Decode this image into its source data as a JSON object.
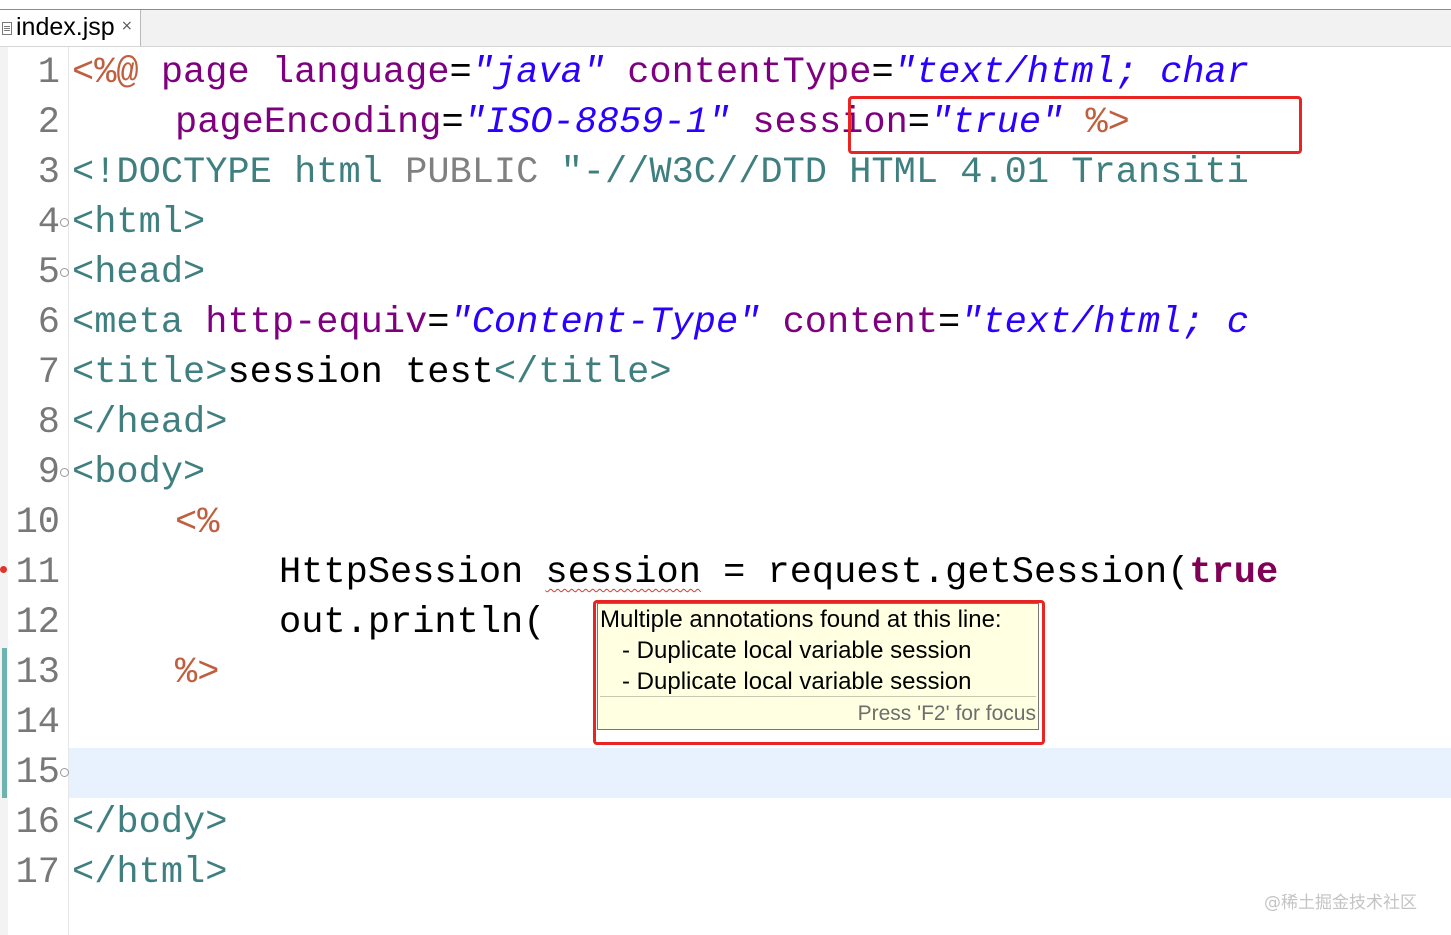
{
  "editor_tab": {
    "title": "index.jsp",
    "close_symbol": "×"
  },
  "line_numbers": [
    "1",
    "2",
    "3",
    "4",
    "5",
    "6",
    "7",
    "8",
    "9",
    "10",
    "11",
    "12",
    "13",
    "14",
    "15",
    "16",
    "17"
  ],
  "code": {
    "l1": {
      "a": "<%@",
      "b": "page",
      "c": "language",
      "d": "=",
      "e": "\"java\"",
      "f": "contentType",
      "g": "=",
      "h": "\"text/html; char"
    },
    "l2": {
      "a": "pageEncoding",
      "b": "=",
      "c": "\"ISO-8859-1\"",
      "d": "session",
      "e": "=",
      "f": "\"true\"",
      "g": "%>"
    },
    "l3": {
      "a": "<!DOCTYPE",
      "b": "html",
      "c": "PUBLIC",
      "d": "\"-//W3C//DTD HTML 4.01 Transiti"
    },
    "l4": {
      "a": "<html>"
    },
    "l5": {
      "a": "<head>"
    },
    "l6": {
      "a": "<meta",
      "b": "http-equiv",
      "c": "=",
      "d": "\"Content-Type\"",
      "e": "content",
      "f": "=",
      "g": "\"text/html; c"
    },
    "l7": {
      "a": "<title>",
      "b": "session test",
      "c": "</title>"
    },
    "l8": {
      "a": "</head>"
    },
    "l9": {
      "a": "<body>"
    },
    "l10": {
      "a": "<%"
    },
    "l11": {
      "a": "HttpSession",
      "b": "session",
      "c": " = request.getSession(",
      "d": "true"
    },
    "l12": {
      "a": "out.println("
    },
    "l13": {
      "a": "%>"
    },
    "l16": {
      "a": "</body>"
    },
    "l17": {
      "a": "</html>"
    }
  },
  "tooltip": {
    "title": "Multiple annotations found at this line:",
    "items": [
      "- Duplicate local variable session",
      "- Duplicate local variable session"
    ],
    "footer": "Press 'F2' for focus"
  },
  "watermark": "@稀土掘金技术社区",
  "colors": {
    "jsp_delimiter": "#bf5f3f",
    "attribute": "#7f007f",
    "string": "#2a00ff",
    "tag": "#3f7f7f",
    "keyword": "#7f0055",
    "highlight_box": "#ea2323",
    "tooltip_bg": "#ffffe1",
    "current_line": "#e8f2fe"
  }
}
